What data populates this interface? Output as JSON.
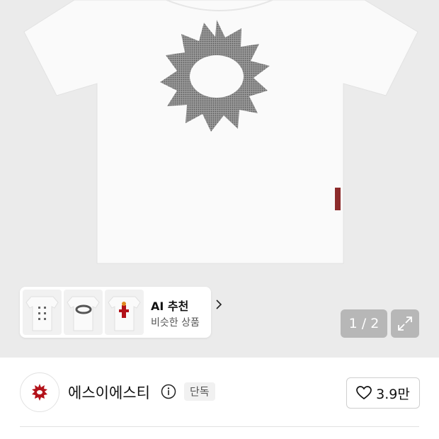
{
  "product_gallery": {
    "image_alt": "white t-shirt with sun graphic",
    "pager_current": "1",
    "pager_total": "2",
    "pager_text": "1 / 2",
    "expand_icon": "expand-arrows-icon"
  },
  "ai_recommendation": {
    "title": "AI 추천",
    "subtitle": "비슷한 상품",
    "thumbnails": [
      "tshirt-grid-print",
      "tshirt-sun-print",
      "tshirt-red-figure-print"
    ]
  },
  "brand": {
    "name": "에스이에스티",
    "badge": "단독",
    "likes": "3.9만",
    "logo_color": "#b3121a"
  },
  "colors": {
    "hero_background": "#ebebeb",
    "text": "#111111",
    "muted": "#555555"
  }
}
